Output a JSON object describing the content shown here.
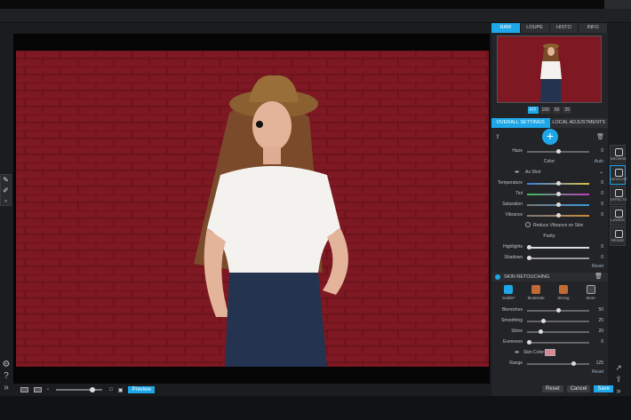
{
  "view_tabs": [
    "RAW",
    "LOUPE",
    "HISTO",
    "INFO"
  ],
  "zoom_levels": [
    "FIT",
    "100",
    "50",
    "25"
  ],
  "panel_tabs": [
    "OVERALL SETTINGS",
    "LOCAL ADJUSTMENTS"
  ],
  "basic": {
    "haze": {
      "label": "Haze",
      "value": "0"
    },
    "color_label": "Color:",
    "auto": "Auto",
    "wb": "As Shot",
    "temperature": {
      "label": "Temperature",
      "value": "0"
    },
    "tint": {
      "label": "Tint",
      "value": "0"
    },
    "saturation": {
      "label": "Saturation",
      "value": "0"
    },
    "vibrance": {
      "label": "Vibrance",
      "value": "0"
    },
    "reduce_vibrance": "Reduce Vibrance on Skin",
    "purity": "Purity:",
    "highlights": {
      "label": "Highlights",
      "value": "0"
    },
    "shadows": {
      "label": "Shadows",
      "value": "0"
    },
    "reset": "Reset"
  },
  "skin": {
    "title": "SKIN RETOUCHING",
    "presets": [
      "Subtle*",
      "Moderate",
      "Strong",
      "More"
    ],
    "blemishes": {
      "label": "Blemishes",
      "value": "50"
    },
    "smoothing": {
      "label": "Smoothing",
      "value": "25"
    },
    "shine": {
      "label": "Shine",
      "value": "20"
    },
    "evenness": {
      "label": "Evenness",
      "value": "0"
    },
    "skin_color": "Skin Color:",
    "range": {
      "label": "Range",
      "value": "125"
    },
    "reset": "Reset"
  },
  "right_tools": [
    "BROWSE",
    "DEVELOP",
    "EFFECTS",
    "LAYERS",
    "RESIZE"
  ],
  "bottom": {
    "preview": "Preview"
  },
  "actions": {
    "reset": "Reset",
    "cancel": "Cancel",
    "save": "Save"
  },
  "colors": {
    "accent": "#1ea7e8",
    "brick": "#7e1822"
  }
}
